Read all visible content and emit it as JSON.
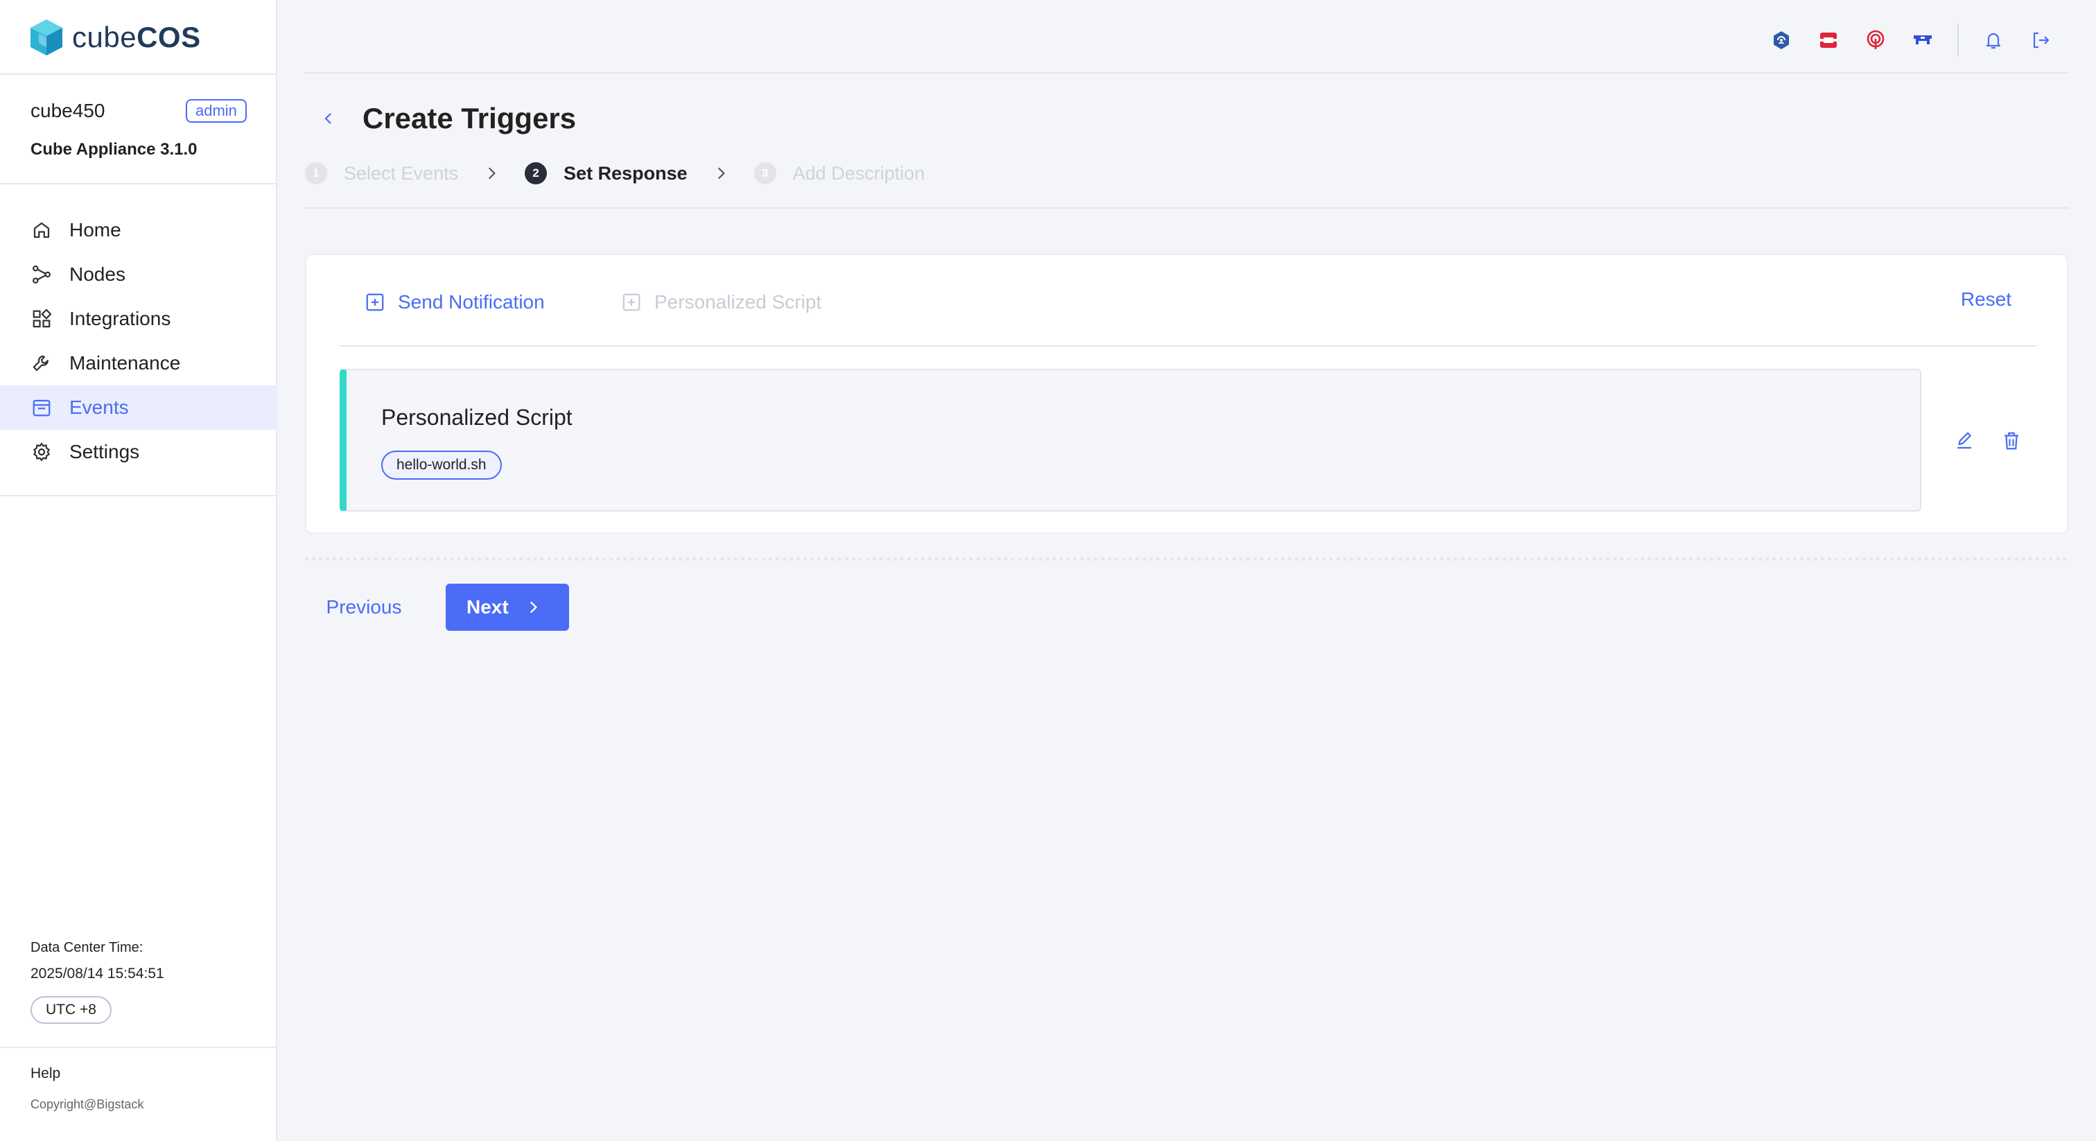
{
  "brand": {
    "name_light": "cube",
    "name_bold": "COS"
  },
  "user": {
    "name": "cube450",
    "role": "admin",
    "appliance": "Cube Appliance 3.1.0"
  },
  "nav": [
    {
      "label": "Home",
      "icon": "home-icon",
      "active": false
    },
    {
      "label": "Nodes",
      "icon": "nodes-icon",
      "active": false
    },
    {
      "label": "Integrations",
      "icon": "integrations-icon",
      "active": false
    },
    {
      "label": "Maintenance",
      "icon": "wrench-icon",
      "active": false
    },
    {
      "label": "Events",
      "icon": "calendar-icon",
      "active": true
    },
    {
      "label": "Settings",
      "icon": "gear-icon",
      "active": false
    }
  ],
  "footer": {
    "dc_label": "Data Center Time:",
    "dc_time": "2025/08/14 15:54:51",
    "timezone": "UTC +8",
    "help": "Help",
    "copyright": "Copyright@Bigstack"
  },
  "topbar_icons": [
    "ceph-icon",
    "openstack-icon",
    "rancher-icon",
    "kubernetes-icon",
    "bell-icon",
    "logout-icon"
  ],
  "page": {
    "title": "Create Triggers",
    "steps": [
      {
        "num": "1",
        "label": "Select Events",
        "state": "inactive"
      },
      {
        "num": "2",
        "label": "Set Response",
        "state": "active"
      },
      {
        "num": "3",
        "label": "Add Description",
        "state": "inactive"
      }
    ]
  },
  "card": {
    "tab_notification": "Send Notification",
    "tab_script": "Personalized Script",
    "reset": "Reset",
    "script_title": "Personalized Script",
    "script_file": "hello-world.sh"
  },
  "actions": {
    "previous": "Previous",
    "next": "Next"
  },
  "colors": {
    "accent": "#4a6cf7",
    "script_bar": "#35d7cb",
    "active_nav_bg": "#e9edfe"
  }
}
